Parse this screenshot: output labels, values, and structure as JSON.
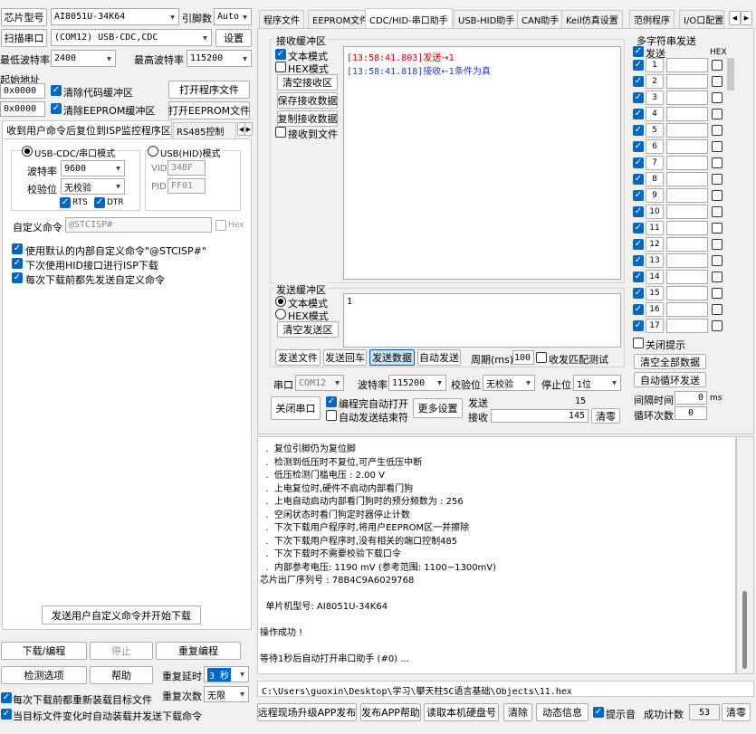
{
  "left": {
    "chip_label": "芯片型号",
    "chip_value": "AI8051U-34K64",
    "pin_label": "引脚数",
    "pin_value": "Auto",
    "scan_button": "扫描串口",
    "port_value": "(COM12) USB-CDC,CDC",
    "settings_button": "设置",
    "min_baud_label": "最低波特率",
    "min_baud_value": "2400",
    "max_baud_label": "最高波特率",
    "max_baud_value": "115200",
    "start_addr_label": "起始地址",
    "addr1": "0x0000",
    "clear_code_label": "清除代码缓冲区",
    "open_prog_button": "打开程序文件",
    "addr2": "0x0000",
    "clear_eeprom_label": "清除EEPROM缓冲区",
    "open_eeprom_button": "打开EEPROM文件",
    "subtab_label": "收到用户命令后复位到ISP监控程序区",
    "subtab2_label": "RS485控制",
    "usb_cdc_mode": "USB-CDC/串口模式",
    "usb_hid_mode": "USB(HID)模式",
    "baud_label": "波特率",
    "baud_value": "9600",
    "parity_label": "校验位",
    "parity_value": "无校验",
    "rts_label": "RTS",
    "dtr_label": "DTR",
    "vid_label": "VID",
    "vid_value": "34BF",
    "pid_label": "PID",
    "pid_value": "FF01",
    "custom_cmd_label": "自定义命令",
    "custom_cmd_value": "@STCISP#",
    "hex_label": "Hex",
    "opt1": "使用默认的内部自定义命令\"@STCISP#\"",
    "opt2": "下次使用HID接口进行ISP下载",
    "opt3": "每次下载前都先发送自定义命令",
    "send_custom_button": "发送用户自定义命令并开始下载",
    "download_button": "下载/编程",
    "stop_button": "停止",
    "reprogram_button": "重复编程",
    "check_button": "检测选项",
    "help_button": "帮助",
    "delay_label": "重复延时",
    "delay_value": "3 秒",
    "count_label": "重复次数",
    "count_value": "无限",
    "reload_label": "每次下载前都重新装载目标文件",
    "auto_reload_label": "当目标文件变化时自动装载并发送下载命令"
  },
  "tabs": [
    "程序文件",
    "EEPROM文件",
    "CDC/HID-串口助手",
    "USB-HID助手",
    "CAN助手",
    "Keil仿真设置",
    "范例程序",
    "I/O口配置"
  ],
  "recv": {
    "group_title": "接收缓冲区",
    "text_mode": "文本模式",
    "hex_mode": "HEX模式",
    "clear_button": "清空接收区",
    "save_button": "保存接收数据",
    "copy_button": "复制接收数据",
    "to_file_label": "接收到文件",
    "lines": [
      {
        "time": "[13:58:41.803]",
        "text": "发送→1",
        "color": "#c00000"
      },
      {
        "time": "[13:58:41.818]",
        "text": "接收←1条件为真",
        "color": "#1f3fbf"
      }
    ]
  },
  "send": {
    "group_title": "发送缓冲区",
    "text_mode": "文本模式",
    "hex_mode": "HEX模式",
    "clear_button": "清空发送区",
    "content": "1",
    "send_file": "发送文件",
    "send_back": "发送回车",
    "send_data": "发送数据",
    "auto_send": "自动发送",
    "period_label": "周期(ms)",
    "period_value": "100",
    "match_label": "收发匹配测试"
  },
  "port": {
    "port_label": "串口",
    "port_value": "COM12",
    "baud_label": "波特率",
    "baud_value": "115200",
    "parity_label": "校验位",
    "parity_value": "无校验",
    "stop_label": "停止位",
    "stop_value": "1位",
    "close_button": "关闭串口",
    "auto_open_label": "编程完自动打开",
    "auto_send_end_label": "自动发送结束符",
    "more_button": "更多设置",
    "send_label": "发送",
    "send_count": "15",
    "recv_label": "接收",
    "recv_count": "145",
    "clear_button": "清零"
  },
  "multi": {
    "title": "多字符串发送",
    "send_label": "发送",
    "hex_label": "HEX",
    "rows": [
      "1",
      "2",
      "3",
      "4",
      "5",
      "6",
      "7",
      "8",
      "9",
      "10",
      "11",
      "12",
      "13",
      "14",
      "15",
      "16",
      "17"
    ],
    "close_hint": "关闭提示",
    "clear_all": "清空全部数据",
    "auto_loop": "自动循环发送",
    "interval_label": "间隔时间",
    "interval_value": "0",
    "interval_unit": "ms",
    "loop_label": "循环次数",
    "loop_value": "0"
  },
  "log": {
    "lines": [
      "  .  复位引脚仍为复位脚",
      "  .  检测到低压时不复位,可产生低压中断",
      "  .  低压检测门槛电压 : 2.00 V",
      "  .  上电复位时,硬件不启动内部看门狗",
      "  .  上电自动启动内部看门狗时的预分频数为 : 256",
      "  .  空闲状态时看门狗定时器停止计数",
      "  .  下次下载用户程序时,将用户EEPROM区一并擦除",
      "  .  下次下载用户程序时,没有相关的端口控制485",
      "  .  下次下载时不需要校验下载口令",
      "  .  内部参考电压: 1190 mV (参考范围: 1100~1300mV)",
      "芯片出厂序列号 : 78B4C9A6029768",
      "",
      "  单片机型号: AI8051U-34K64",
      "",
      "操作成功 !",
      "",
      "等待1秒后自动打开串口助手 (#0) ..."
    ],
    "path": "C:\\Users\\guoxin\\Desktop\\学习\\攀天柱5C语言基础\\Objects\\11.hex"
  },
  "bottom": {
    "upgrade_button": "远程现场升级APP发布",
    "publish_button": "发布APP帮助",
    "read_disk_button": "读取本机硬盘号",
    "clear_button": "清除",
    "dynamic_button": "动态信息",
    "tone_label": "提示音",
    "success_label": "成功计数",
    "success_value": "53",
    "clear_count_button": "清零"
  }
}
